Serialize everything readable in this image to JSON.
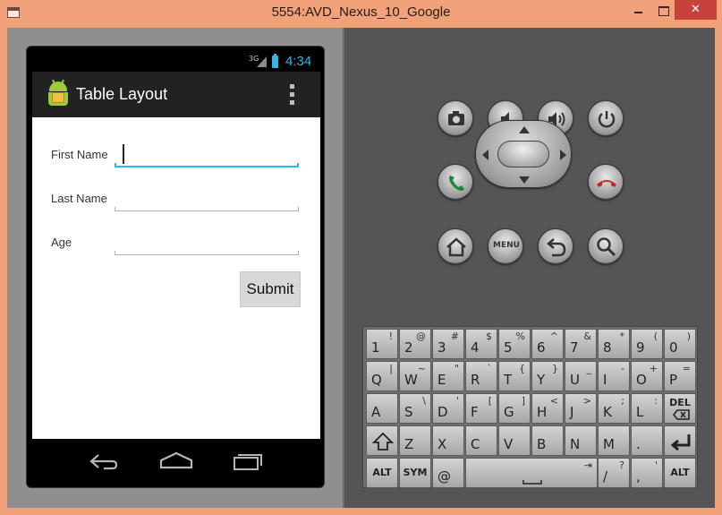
{
  "window": {
    "title": "5554:AVD_Nexus_10_Google",
    "controls": {
      "minimize": "",
      "maximize": "",
      "close": "✕"
    }
  },
  "status_bar": {
    "network": "3G",
    "time": "4:34"
  },
  "action_bar": {
    "title": "Table Layout",
    "icon": "android-app-icon",
    "overflow_icon": "overflow-menu-icon"
  },
  "form": {
    "fields": [
      {
        "label": "First Name",
        "value": "",
        "focused": true
      },
      {
        "label": "Last Name",
        "value": "",
        "focused": false
      },
      {
        "label": "Age",
        "value": "",
        "focused": false
      }
    ],
    "submit_label": "Submit"
  },
  "nav_bar": {
    "icons": [
      "back-icon",
      "home-icon",
      "recent-apps-icon"
    ]
  },
  "emulator_buttons": {
    "row1": [
      "camera-icon",
      "volume-down-icon",
      "volume-up-icon",
      "power-icon"
    ],
    "row2": [
      "call-icon",
      "dpad",
      "end-call-icon"
    ],
    "row3": [
      "home-icon",
      "menu-button",
      "back-icon",
      "search-icon"
    ],
    "menu_label": "MENU"
  },
  "keyboard": {
    "row1": [
      {
        "k": "1",
        "a": "!"
      },
      {
        "k": "2",
        "a": "@"
      },
      {
        "k": "3",
        "a": "#"
      },
      {
        "k": "4",
        "a": "$"
      },
      {
        "k": "5",
        "a": "%"
      },
      {
        "k": "6",
        "a": "^"
      },
      {
        "k": "7",
        "a": "&"
      },
      {
        "k": "8",
        "a": "*"
      },
      {
        "k": "9",
        "a": "("
      },
      {
        "k": "0",
        "a": ")"
      }
    ],
    "row2": [
      {
        "k": "Q",
        "a": "|"
      },
      {
        "k": "W",
        "a": "~"
      },
      {
        "k": "E",
        "a": "\""
      },
      {
        "k": "R",
        "a": "`"
      },
      {
        "k": "T",
        "a": "{"
      },
      {
        "k": "Y",
        "a": "}"
      },
      {
        "k": "U",
        "a": "_"
      },
      {
        "k": "I",
        "a": "-"
      },
      {
        "k": "O",
        "a": "+"
      },
      {
        "k": "P",
        "a": "="
      }
    ],
    "row3": [
      {
        "k": "A",
        "a": ""
      },
      {
        "k": "S",
        "a": "\\"
      },
      {
        "k": "D",
        "a": "'"
      },
      {
        "k": "F",
        "a": "["
      },
      {
        "k": "G",
        "a": "]"
      },
      {
        "k": "H",
        "a": "<"
      },
      {
        "k": "J",
        "a": ">"
      },
      {
        "k": "K",
        "a": ";"
      },
      {
        "k": "L",
        "a": ":"
      },
      {
        "k": "DEL",
        "a": ""
      }
    ],
    "row4": [
      {
        "k": "⇧",
        "a": ""
      },
      {
        "k": "Z",
        "a": ""
      },
      {
        "k": "X",
        "a": ""
      },
      {
        "k": "C",
        "a": ""
      },
      {
        "k": "V",
        "a": ""
      },
      {
        "k": "B",
        "a": ""
      },
      {
        "k": "N",
        "a": ""
      },
      {
        "k": "M",
        "a": ""
      },
      {
        "k": ".",
        "a": ""
      },
      {
        "k": "↵",
        "a": ""
      }
    ],
    "row5": [
      {
        "k": "ALT",
        "a": ""
      },
      {
        "k": "SYM",
        "a": ""
      },
      {
        "k": "@",
        "a": ""
      },
      {
        "k": "space",
        "a": "⇥"
      },
      {
        "k": "/",
        "a": "?"
      },
      {
        "k": ",",
        "a": "'"
      },
      {
        "k": "ALT",
        "a": ""
      }
    ]
  }
}
